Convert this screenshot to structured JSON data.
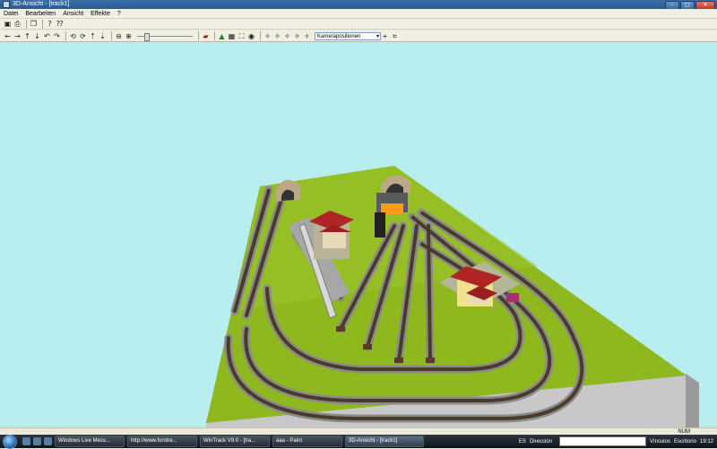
{
  "window": {
    "title": "3D-Ansicht - [track1]"
  },
  "menu": [
    "Datei",
    "Bearbeiten",
    "Ansicht",
    "Effekte",
    "?"
  ],
  "toolbar2": {
    "camera_combo": "Kamerapositionen"
  },
  "status": {
    "num": "NUM"
  },
  "taskbar": {
    "tasks": [
      "Windows Live Mess...",
      "http://www.forotre...",
      "WinTrack V9.0 - [tra...",
      "aaa - Paint",
      "3D-Ansicht - [track1]"
    ],
    "lang": "ES",
    "address_label": "Dirección",
    "links_label": "Vínculos",
    "desktop_label": "Escritorio",
    "clock": "19:12"
  },
  "icons": {
    "toolbar1": [
      "save-icon",
      "print-icon",
      "copy-icon",
      "help-icon",
      "context-help-icon"
    ],
    "toolbar2": [
      "arrow-left-icon",
      "arrow-right-icon",
      "arrow-up-icon",
      "arrow-down-icon",
      "rotate-left-icon",
      "rotate-right-icon",
      "walk-left-icon",
      "walk-right-icon",
      "zoom-out-icon",
      "zoom-in-icon",
      "train-icon",
      "terrain-icon",
      "grid-icon",
      "fit-view-icon",
      "camera-icon",
      "light-icon"
    ]
  },
  "colors": {
    "sky": "#b8eef0",
    "terrain": "#8fb81f",
    "base": "#c9c9c9",
    "titlebar": "#2c5a8c"
  },
  "zoom_slider": {
    "value": 0.1
  }
}
